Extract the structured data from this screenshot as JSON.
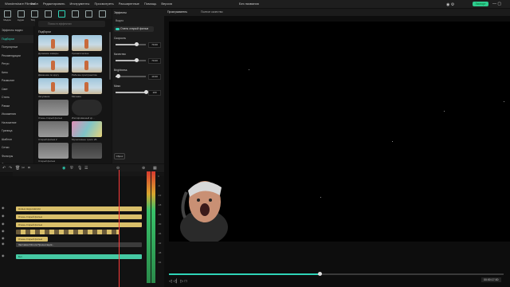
{
  "menubar": {
    "app_title": "Wondershare Filmora",
    "menus": [
      "Файл",
      "Редактировать",
      "Инструменты",
      "Просмотреть",
      "Расширенные",
      "Помощь",
      "Версия"
    ],
    "filename": "Без названия",
    "export_label": "Экспорт"
  },
  "toolbar": {
    "items": [
      {
        "label": "Медиа",
        "icon": "media-icon"
      },
      {
        "label": "Аудио",
        "icon": "music-icon"
      },
      {
        "label": "Титры",
        "icon": "text-icon"
      },
      {
        "label": "Переходы",
        "icon": "transition-icon"
      },
      {
        "label": "Эффекты",
        "icon": "effects-icon",
        "active": true
      },
      {
        "label": "Стикеры",
        "icon": "sticker-icon"
      },
      {
        "label": "Шаблоны",
        "icon": "template-icon"
      },
      {
        "label": "Экспорт",
        "icon": "export-icon"
      }
    ]
  },
  "leftnav": {
    "items": [
      "Эффекты видео",
      "Подборки",
      "Популярные",
      "Рекомендации",
      "Ретро",
      "Кино",
      "Размытие",
      "Свет",
      "Стиль",
      "Рамки",
      "Искажения",
      "Наложение",
      "Граница",
      "Шаблон",
      "Сетки",
      "Фильтры",
      "Фильтры света"
    ],
    "selected_index": 1
  },
  "grid": {
    "search_placeholder": "Поиск в эффектах",
    "section_label": "Подборки",
    "thumbs": [
      {
        "label": "Дрожание камеры"
      },
      {
        "label": "Хроматическое"
      },
      {
        "label": "Движение по кругу"
      },
      {
        "label": "Рабочие пространства"
      },
      {
        "label": "Затухание"
      },
      {
        "label": "Мигание"
      },
      {
        "label": "Очень старый фильм"
      },
      {
        "label": "Изолированный кр..."
      },
      {
        "label": "Старый фильм 2"
      },
      {
        "label": "Мультяшные трилл 2Б"
      },
      {
        "label": "Старый фильм"
      },
      {
        "label": ""
      }
    ]
  },
  "props": {
    "tabs": [
      "Эффекты",
      "Видео"
    ],
    "effect_name": "Очень старый фильм",
    "params": [
      {
        "label": "Скорость",
        "value": "70.00",
        "level": 0.7
      },
      {
        "label": "Качество",
        "value": "70.00",
        "level": 0.7
      },
      {
        "label": "Brightness",
        "value": "10.00",
        "level": 0.1
      },
      {
        "label": "Микс",
        "value": "100",
        "level": 1.0
      }
    ],
    "reset_label": "Сброс"
  },
  "player": {
    "tabs": [
      "Проигрыватель",
      "Полное качество"
    ],
    "progress": 0.45,
    "timecode": "00:00:17:00"
  },
  "timeline": {
    "tracks": [
      {
        "name": "Новые видеозаписи",
        "color": "yellow"
      },
      {
        "name": "Очень старый фильм",
        "color": "yellow"
      },
      {
        "name": "Очень старый фильм",
        "color": "yellow"
      },
      {
        "name": "",
        "color": "multi"
      },
      {
        "name": "Очень старый фильм",
        "color": "yellow"
      },
      {
        "name": "Заставка Filmora Презентация...",
        "color": "dark"
      },
      {
        "name": "Бит",
        "color": "green"
      }
    ],
    "meter_ticks": [
      "0",
      "-6",
      "-12",
      "-18",
      "-24",
      "-30",
      "-36",
      "-42",
      "-48",
      "-54"
    ]
  },
  "colors": {
    "accent": "#2ed3b7",
    "playhead": "#ff3b3b"
  }
}
